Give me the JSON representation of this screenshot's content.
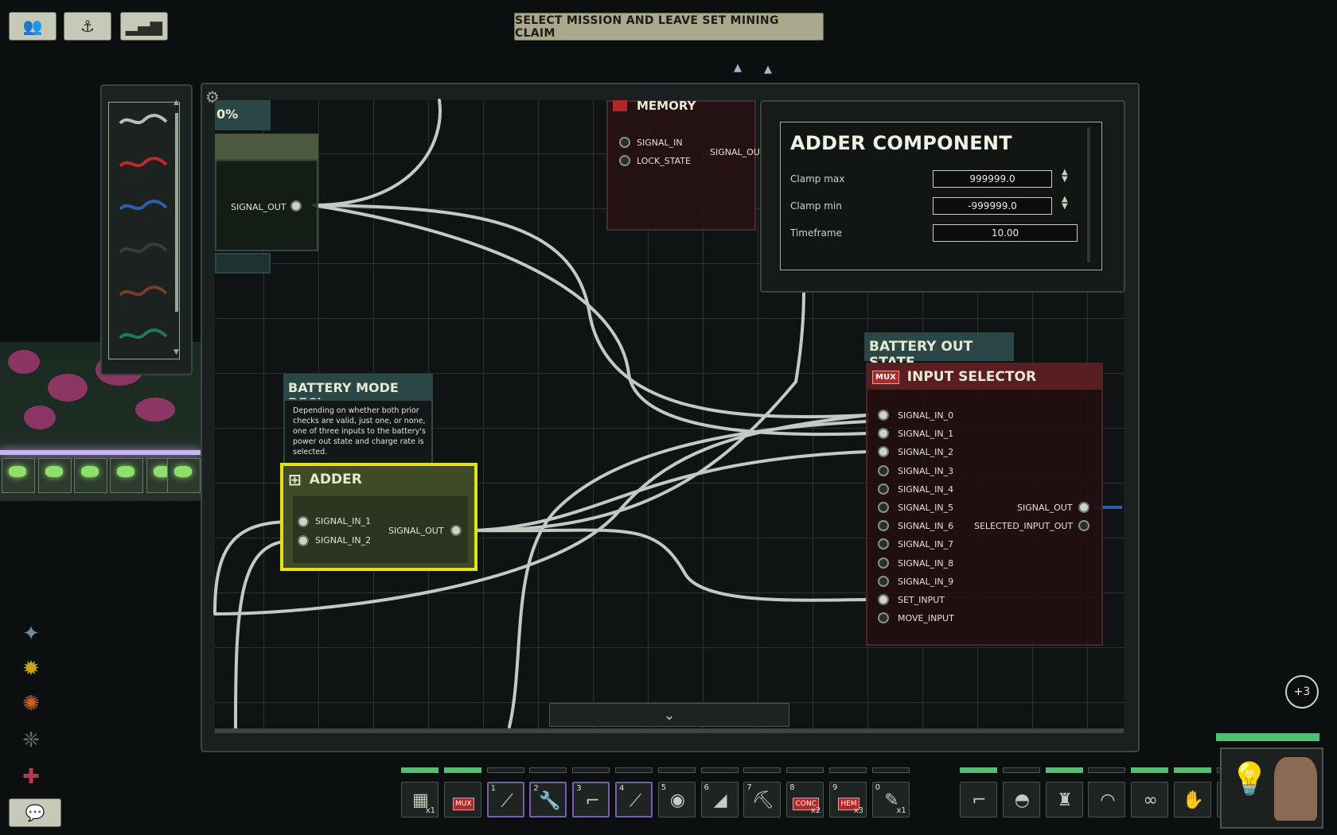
{
  "top_bar": {
    "mission_button": "SELECT MISSION AND LEAVE SET MINING CLAIM",
    "crew_icon": "crew-icon",
    "submarine_icon": "submarine-icon",
    "stats_icon": "stats-icon"
  },
  "colors": {
    "wire_grey": "#b9bdb4",
    "wire_red": "#c0262a",
    "wire_blue": "#2b5fa8",
    "wire_black": "#2a2a2a",
    "wire_brown": "#7a3a2c",
    "wire_green": "#1f7a5a",
    "selected_outline": "#e3e21a",
    "mux_red": "#b3262a"
  },
  "palette": {
    "wires": [
      "grey-wire",
      "red-wire",
      "blue-wire",
      "black-wire",
      "brown-wire",
      "green-wire"
    ]
  },
  "canvas": {
    "partial_label": "0%",
    "top_left_port": "SIGNAL_OUT",
    "memory": {
      "title": "MEMORY",
      "ports": [
        "SIGNAL_IN",
        "LOCK_STATE"
      ],
      "output": "SIGNAL_OUT"
    },
    "battery_mode": {
      "title": "BATTERY MODE DECI...",
      "description": "Depending on whether both prior checks are valid, just one, or none, one of three inputs to the battery's power out state and charge rate is selected."
    },
    "adder": {
      "title": "ADDER",
      "inputs": [
        "SIGNAL_IN_1",
        "SIGNAL_IN_2"
      ],
      "output": "SIGNAL_OUT"
    },
    "battery_out_state": {
      "title": "BATTERY OUT STATE"
    },
    "input_selector": {
      "title": "INPUT SELECTOR",
      "badge": "MUX",
      "inputs": [
        "SIGNAL_IN_0",
        "SIGNAL_IN_1",
        "SIGNAL_IN_2",
        "SIGNAL_IN_3",
        "SIGNAL_IN_4",
        "SIGNAL_IN_5",
        "SIGNAL_IN_6",
        "SIGNAL_IN_7",
        "SIGNAL_IN_8",
        "SIGNAL_IN_9",
        "SET_INPUT",
        "MOVE_INPUT"
      ],
      "outputs": [
        "SIGNAL_OUT",
        "SELECTED_INPUT_OUT"
      ]
    }
  },
  "adder_panel": {
    "title": "ADDER COMPONENT",
    "fields": [
      {
        "label": "Clamp max",
        "value": "999999.0"
      },
      {
        "label": "Clamp min",
        "value": "-999999.0"
      },
      {
        "label": "Timeframe",
        "value": "10.00"
      }
    ]
  },
  "hotbar": {
    "slots": [
      {
        "num": "",
        "icon": "circuit-board-icon",
        "qty": "x1"
      },
      {
        "num": "",
        "icon": "mux-chip-icon",
        "qty": "",
        "badge": "MUX"
      },
      {
        "num": "1",
        "icon": "screwdriver-icon",
        "qty": ""
      },
      {
        "num": "2",
        "icon": "wrench-icon",
        "qty": ""
      },
      {
        "num": "3",
        "icon": "rifle-icon",
        "qty": ""
      },
      {
        "num": "4",
        "icon": "screwdriver-icon",
        "qty": ""
      },
      {
        "num": "5",
        "icon": "diving-mask-icon",
        "qty": ""
      },
      {
        "num": "6",
        "icon": "flashlight-icon",
        "qty": ""
      },
      {
        "num": "7",
        "icon": "welding-tool-icon",
        "qty": ""
      },
      {
        "num": "8",
        "icon": "conc-chip-icon",
        "qty": "x2",
        "badge": "CONC"
      },
      {
        "num": "9",
        "icon": "hem-chip-icon",
        "qty": "x3",
        "badge": "HEM"
      },
      {
        "num": "0",
        "icon": "syringe-icon",
        "qty": "x1"
      }
    ],
    "equipment": [
      "gun-icon",
      "helmet-icon",
      "suit-icon",
      "cap-icon",
      "goggles-icon",
      "gloves-icon",
      "id-card-icon"
    ]
  },
  "side_icons": [
    "talent-icon",
    "skill-icon",
    "fire-icon",
    "tree-icon",
    "medic-icon"
  ],
  "notification": {
    "count": "+3"
  }
}
